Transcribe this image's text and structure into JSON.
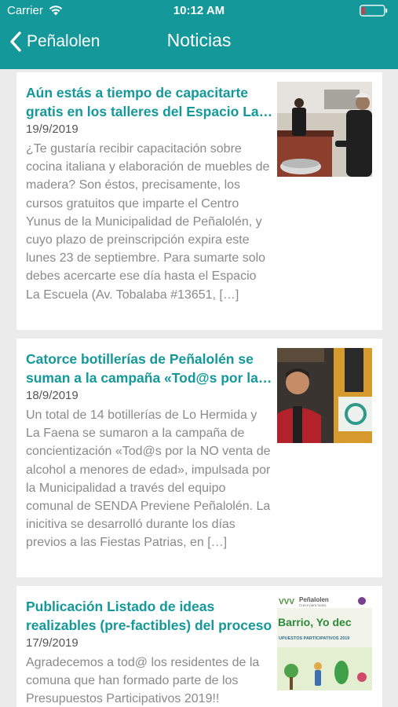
{
  "status_bar": {
    "carrier": "Carrier",
    "time": "10:12 AM",
    "battery_color": "#e0344a"
  },
  "nav": {
    "back_label": "Peñalolen",
    "title": "Noticias"
  },
  "colors": {
    "accent": "#14989a",
    "background": "#ebebeb"
  },
  "news": [
    {
      "title_line1": "Aún estás a tiempo de capacitarte",
      "title_line2": "gratis en los talleres del Espacio La Escuela",
      "date": "19/9/2019",
      "excerpt": "¿Te gustaría recibir capacitación sobre cocina italiana y elaboración de muebles de madera? Son éstos, precisamente, los cursos gratuitos que imparte el Centro Yunus de la Municipalidad de Peñalolén, y cuyo plazo de preinscripción expira este lunes 23 de septiembre. Para sumarte solo debes acercarte ese día hasta el Espacio La Escuela  (Av. Tobalaba #13651, […]",
      "image": "kitchen-workshop-photo"
    },
    {
      "title_line1": "Catorce botillerías de Peñalolén se",
      "title_line2": "suman a la campaña «Tod@s por la NO venta",
      "date": "18/9/2019",
      "excerpt": "Un total de 14 botillerías de Lo Hermida y La Faena se sumaron a la campaña de concientización «Tod@s por la NO venta de alcohol a menores de edad», impulsada por la Municipalidad a través del equipo comunal de SENDA Previene Peñalolén. La inicitiva se desarrolló durante los días previos a las Fiestas Patrias, en […]",
      "image": "liquor-store-owner-photo"
    },
    {
      "title_line1": "Publicación Listado de ideas",
      "title_line2": "realizables (pre-factibles) del proceso",
      "date": "17/9/2019",
      "excerpt": "Agradecemos a tod@ los residentes de la comuna que han formado parte de los Presupuestos Participativos 2019!!",
      "image": "participatory-budget-poster",
      "poster_logo": "Peñalolen",
      "poster_tagline": "Crece para todos",
      "poster_headline": "Barrio, Yo dec",
      "poster_subline": "UPUESTOS PARTICIPATIVOS 2019"
    }
  ]
}
